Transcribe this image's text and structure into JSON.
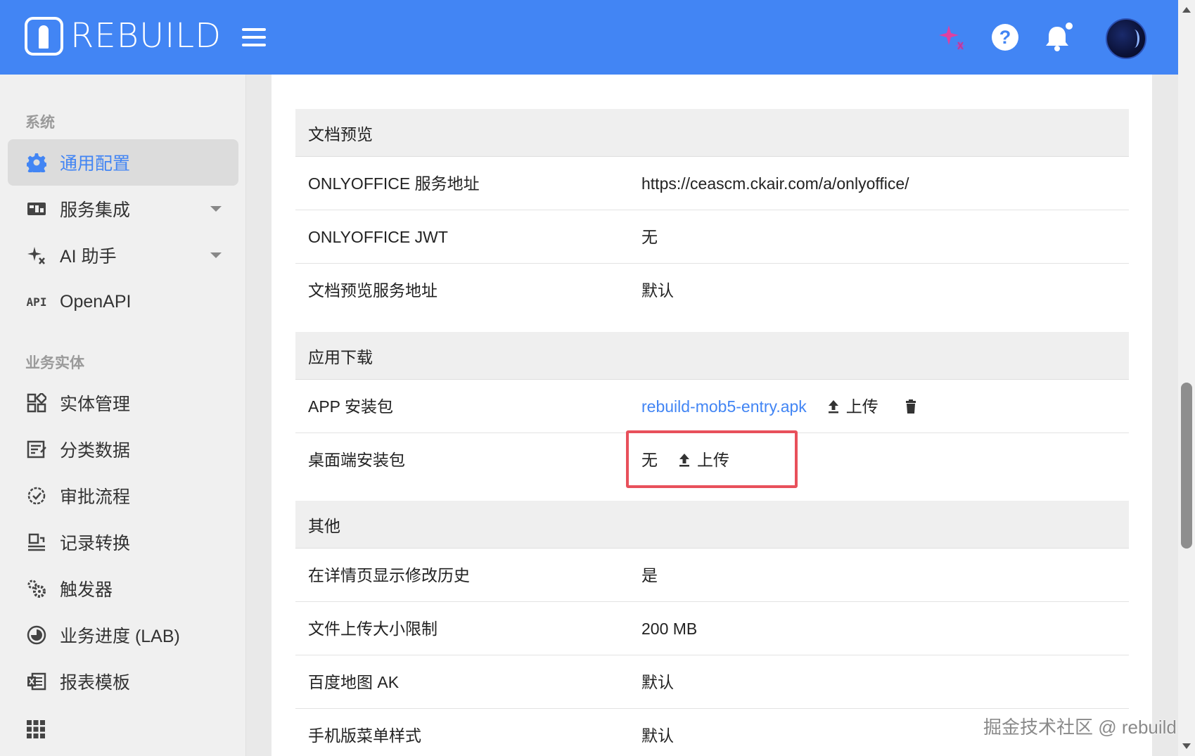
{
  "header": {
    "brand": "REBUILD",
    "icons": [
      "ai-sparkle-icon",
      "help-icon",
      "bell-icon",
      "avatar"
    ]
  },
  "sidebar": {
    "section_system": "系统",
    "section_entities": "业务实体",
    "items": [
      {
        "label": "通用配置",
        "icon": "gear-icon",
        "active": true
      },
      {
        "label": "服务集成",
        "icon": "integration-icon"
      },
      {
        "label": "AI 助手",
        "icon": "ai-sparkle-icon"
      },
      {
        "label": "OpenAPI",
        "icon_text": "API"
      },
      {
        "label": "实体管理",
        "icon": "entity-grid-icon"
      },
      {
        "label": "分类数据",
        "icon": "classification-icon"
      },
      {
        "label": "审批流程",
        "icon": "approval-icon"
      },
      {
        "label": "记录转换",
        "icon": "transform-icon"
      },
      {
        "label": "触发器",
        "icon": "trigger-gears-icon"
      },
      {
        "label": "业务进度 (LAB)",
        "icon": "progress-icon"
      },
      {
        "label": "报表模板",
        "icon": "excel-icon"
      }
    ]
  },
  "sections": {
    "preview": {
      "title": "文档预览",
      "rows": [
        {
          "label": "ONLYOFFICE 服务地址",
          "value": "https://ceascm.ckair.com/a/onlyoffice/"
        },
        {
          "label": "ONLYOFFICE JWT",
          "value": "无"
        },
        {
          "label": "文档预览服务地址",
          "value": "默认"
        }
      ]
    },
    "download": {
      "title": "应用下载",
      "app_label": "APP 安装包",
      "app_file": "rebuild-mob5-entry.apk",
      "desktop_label": "桌面端安装包",
      "desktop_value": "无",
      "upload_label": "上传"
    },
    "other": {
      "title": "其他",
      "rows": [
        {
          "label": "在详情页显示修改历史",
          "value": "是"
        },
        {
          "label": "文件上传大小限制",
          "value": "200 MB"
        },
        {
          "label": "百度地图 AK",
          "value": "默认"
        },
        {
          "label": "手机版菜单样式",
          "value": "默认"
        }
      ]
    }
  },
  "watermark": "掘金技术社区 @ rebuild",
  "colors": {
    "brand": "#4285f4",
    "highlight": "#e8505b"
  }
}
